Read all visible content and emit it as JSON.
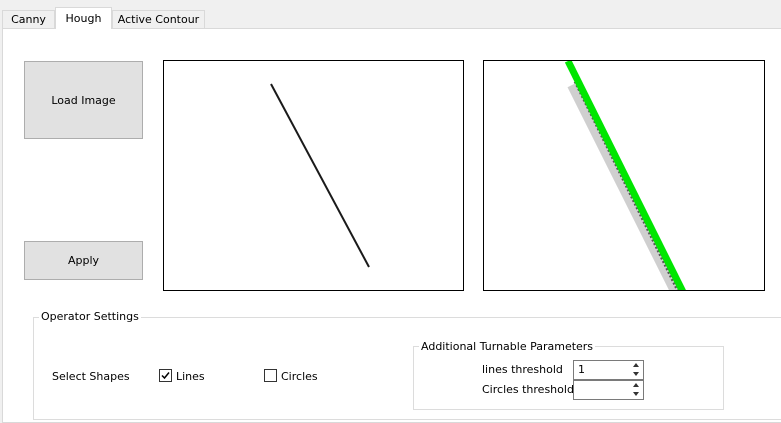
{
  "tabs": [
    {
      "label": "Canny",
      "active": false
    },
    {
      "label": "Hough",
      "active": true
    },
    {
      "label": "Active Contour",
      "active": false
    }
  ],
  "buttons": {
    "load_image": "Load Image",
    "apply": "Apply"
  },
  "colors": {
    "detected_line": "#00e600",
    "input_line": "#1a1a1a"
  },
  "operator_settings": {
    "title": "Operator Settings",
    "select_shapes_label": "Select Shapes",
    "lines": {
      "label": "Lines",
      "checked": true
    },
    "circles": {
      "label": "Circles",
      "checked": false
    }
  },
  "params": {
    "title": "Additional Turnable Parameters",
    "lines_threshold": {
      "label": "lines threshold",
      "value": "1"
    },
    "circles_threshold": {
      "label": "Circles threshold",
      "value": ""
    }
  }
}
